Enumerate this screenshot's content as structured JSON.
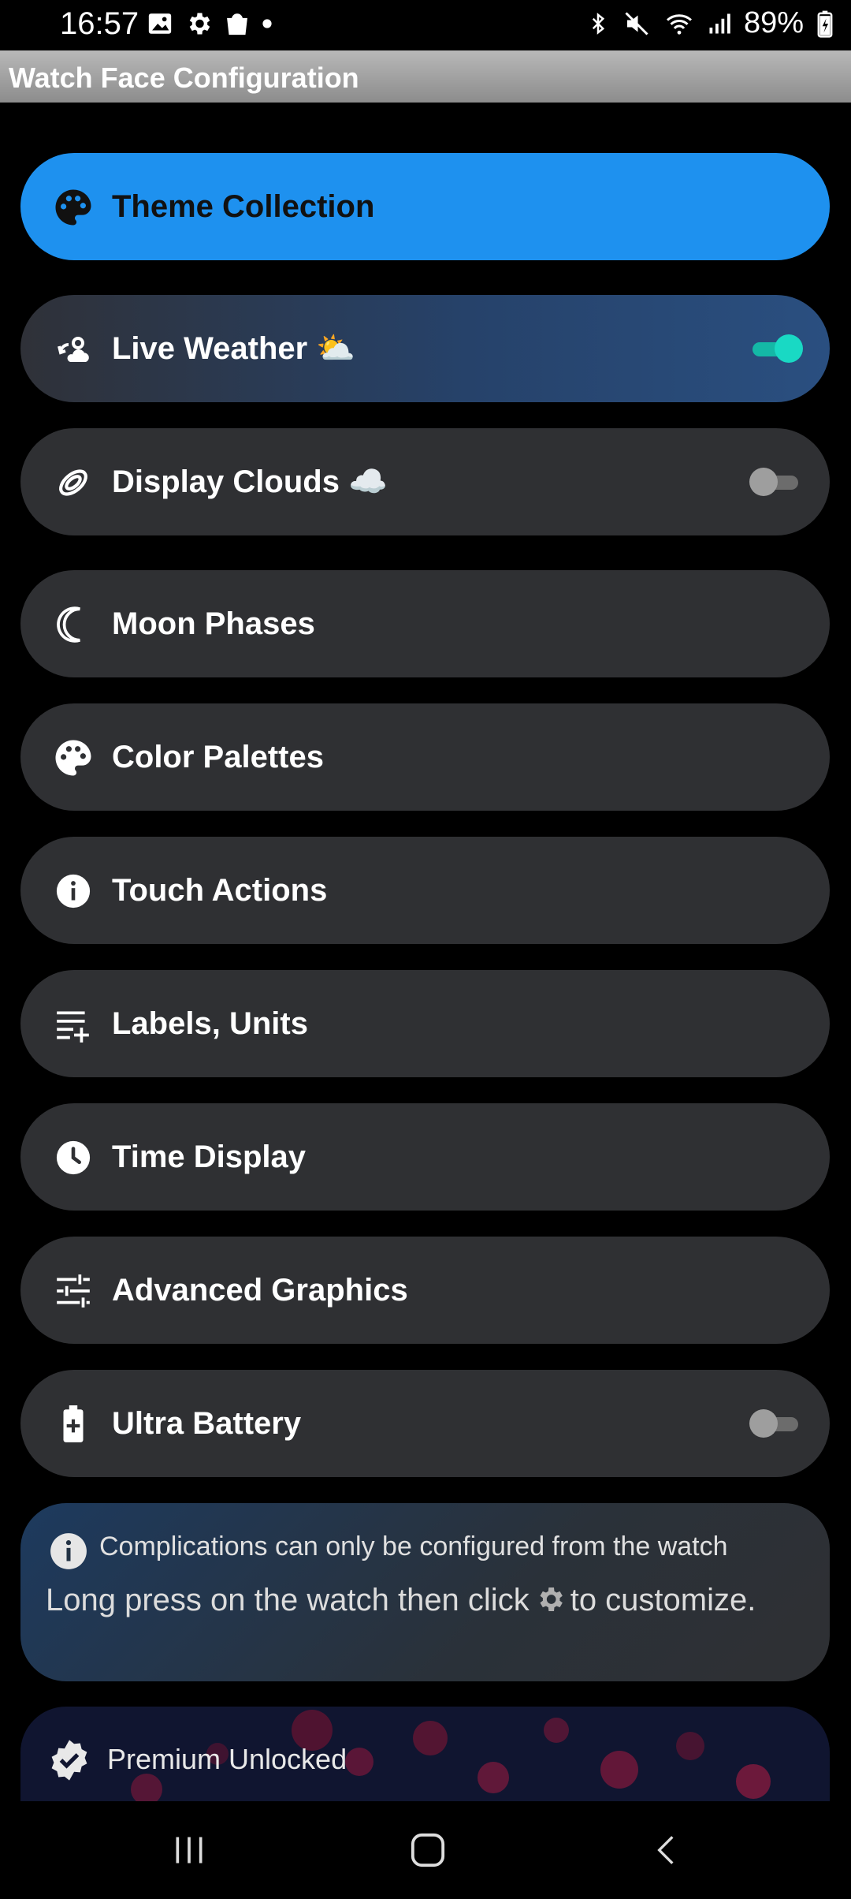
{
  "status_bar": {
    "time": "16:57",
    "battery_percent": "89%",
    "left_icons": [
      "image-icon",
      "gear-icon",
      "shopping-bag-icon",
      "dot-icon"
    ],
    "right_icons": [
      "bluetooth-icon",
      "mute-icon",
      "wifi-icon",
      "signal-icon",
      "battery-charging-icon"
    ]
  },
  "header": {
    "title": "Watch Face Configuration"
  },
  "menu": [
    {
      "label": "Theme Collection",
      "icon": "palette-icon"
    },
    {
      "label": "Live Weather ⛅",
      "icon": "weather-icon",
      "toggle": true
    },
    {
      "label": "Display Clouds ☁️",
      "icon": "clouds-icon",
      "toggle": false
    },
    {
      "label": "Moon Phases",
      "icon": "moon-icon"
    },
    {
      "label": "Color Palettes",
      "icon": "palette-icon"
    },
    {
      "label": "Touch Actions",
      "icon": "info-icon"
    },
    {
      "label": "Labels, Units",
      "icon": "list-add-icon"
    },
    {
      "label": "Time Display",
      "icon": "clock-icon"
    },
    {
      "label": "Advanced Graphics",
      "icon": "sliders-icon"
    },
    {
      "label": "Ultra Battery",
      "icon": "battery-plus-icon",
      "toggle": false
    }
  ],
  "info_card": {
    "heading": "Complications can only be configured from the watch",
    "body_before": "Long press on the watch then click",
    "body_after": "to customize."
  },
  "premium_card": {
    "title": "Premium Unlocked"
  },
  "colors": {
    "accent": "#1e91ef",
    "toggle_on": "#19d9c4",
    "button_bg": "#2f3033"
  }
}
